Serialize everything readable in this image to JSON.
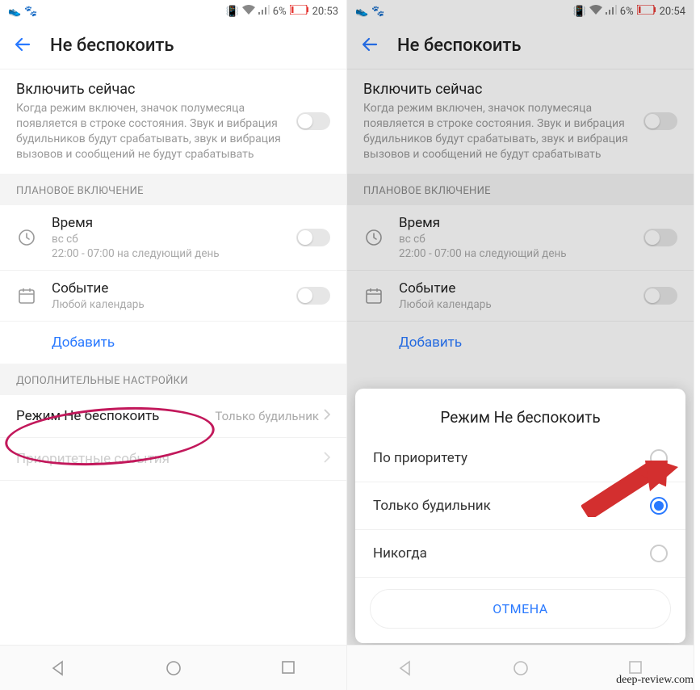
{
  "status": {
    "battery_pct": "6%",
    "time_left": "20:53",
    "time_right": "20:54"
  },
  "header": {
    "title": "Не беспокоить"
  },
  "enable": {
    "title": "Включить сейчас",
    "desc": "Когда режим включен, значок полумесяца появляется в строке состояния. Звук и вибрация будильников будут срабатывать, звук и вибрация вызовов и сообщений не будут срабатывать"
  },
  "sections": {
    "scheduled": "ПЛАНОВОЕ ВКЛЮЧЕНИЕ",
    "additional": "ДОПОЛНИТЕЛЬНЫЕ НАСТРОЙКИ"
  },
  "schedule": {
    "time_title": "Время",
    "time_days": "вс сб",
    "time_range": "22:00 - 07:00 на следующий день",
    "event_title": "Событие",
    "event_sub": "Любой календарь",
    "add": "Добавить"
  },
  "settings": {
    "mode_label": "Режим Не беспокоить",
    "mode_value": "Только будильник",
    "priority_label": "Приоритетные события"
  },
  "modal": {
    "title": "Режим Не беспокоить",
    "opt1": "По приоритету",
    "opt2": "Только будильник",
    "opt3": "Никогда",
    "cancel": "ОТМЕНА"
  },
  "watermark": "deep-review.com"
}
